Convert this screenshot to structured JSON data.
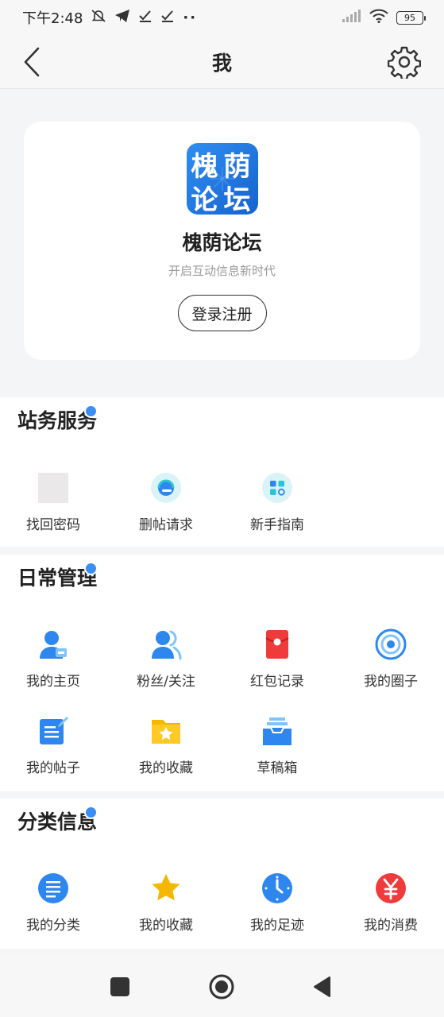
{
  "status_bar": {
    "time": "下午2:48",
    "dots": "··",
    "battery": "95"
  },
  "header": {
    "title": "我"
  },
  "profile": {
    "app_name": "槐荫论坛",
    "slogan": "开启互动信息新时代",
    "login_label": "登录注册",
    "logo_text": [
      "槐",
      "荫",
      "论",
      "坛"
    ]
  },
  "sections": {
    "site": {
      "title": "站务服务",
      "items": [
        {
          "label": "找回密码",
          "icon": "blank-icon"
        },
        {
          "label": "删帖请求",
          "icon": "headset-icon"
        },
        {
          "label": "新手指南",
          "icon": "apps-icon"
        }
      ]
    },
    "daily": {
      "title": "日常管理",
      "items": [
        {
          "label": "我的主页",
          "icon": "user-card-icon"
        },
        {
          "label": "粉丝/关注",
          "icon": "users-icon"
        },
        {
          "label": "红包记录",
          "icon": "red-envelope-icon"
        },
        {
          "label": "我的圈子",
          "icon": "circle-target-icon"
        },
        {
          "label": "我的帖子",
          "icon": "edit-note-icon"
        },
        {
          "label": "我的收藏",
          "icon": "folder-star-icon"
        },
        {
          "label": "草稿箱",
          "icon": "inbox-icon"
        }
      ]
    },
    "category": {
      "title": "分类信息",
      "items": [
        {
          "label": "我的分类",
          "icon": "list-icon"
        },
        {
          "label": "我的收藏",
          "icon": "star-icon"
        },
        {
          "label": "我的足迹",
          "icon": "clock-icon"
        },
        {
          "label": "我的消费",
          "icon": "yuan-icon"
        }
      ]
    }
  },
  "colors": {
    "accent": "#3a8ef4",
    "red": "#ef3b3b",
    "gold": "#f5b800"
  }
}
